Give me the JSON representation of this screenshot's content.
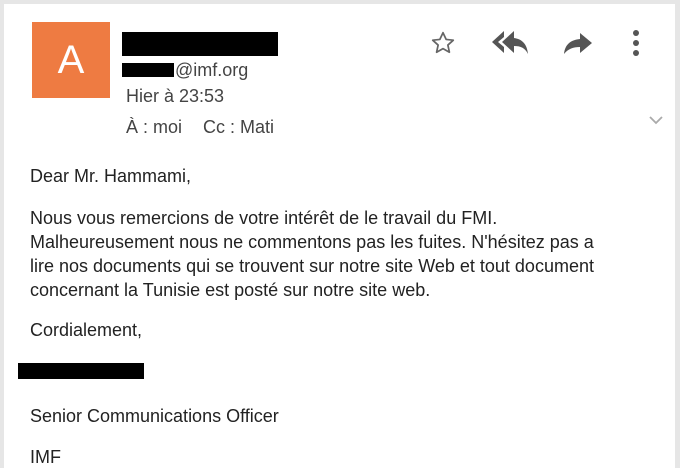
{
  "email": {
    "avatar_letter": "A",
    "sender_email_domain": "@imf.org",
    "date": "Hier à 23:53",
    "to": "À : moi",
    "cc": "Cc : Mati",
    "body": {
      "greeting": "Dear Mr. Hammami,",
      "paragraph_lines": [
        "Nous vous remercions de votre intérêt de le travail du FMI.",
        "Malheureusement nous ne commentons pas les fuites. N'hésitez pas a",
        "lire nos documents qui se trouvent sur notre site Web et tout document",
        "concernant la Tunisie est posté sur notre site web."
      ],
      "closing": "Cordialement,",
      "signature_title": "Senior Communications Officer",
      "signature_org": "IMF"
    }
  },
  "icons": {
    "star": "star-outline-icon",
    "reply_all": "reply-all-icon",
    "forward": "forward-icon",
    "more": "more-vert-icon",
    "expand": "chevron-down-icon"
  },
  "colors": {
    "avatar_bg": "#ee7b42",
    "icon_gray": "#666666",
    "page_bg": "#e6e6e6"
  }
}
